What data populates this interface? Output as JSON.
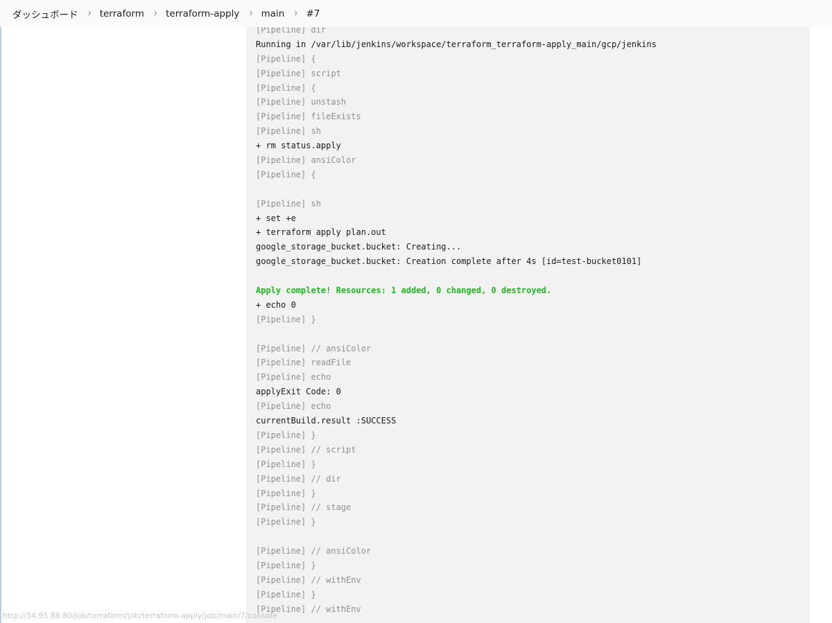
{
  "breadcrumb": {
    "items": [
      "ダッシュボード",
      "terraform",
      "terraform-apply",
      "main",
      "#7"
    ],
    "separator": "›"
  },
  "console": {
    "lines": [
      {
        "text": "[Pipeline] dir",
        "kind": "pipeline"
      },
      {
        "text": "Running in /var/lib/jenkins/workspace/terraform_terraform-apply_main/gcp/jenkins",
        "kind": "output"
      },
      {
        "text": "[Pipeline] {",
        "kind": "pipeline"
      },
      {
        "text": "[Pipeline] script",
        "kind": "pipeline"
      },
      {
        "text": "[Pipeline] {",
        "kind": "pipeline"
      },
      {
        "text": "[Pipeline] unstash",
        "kind": "pipeline"
      },
      {
        "text": "[Pipeline] fileExists",
        "kind": "pipeline"
      },
      {
        "text": "[Pipeline] sh",
        "kind": "pipeline"
      },
      {
        "text": "+ rm status.apply",
        "kind": "output"
      },
      {
        "text": "[Pipeline] ansiColor",
        "kind": "pipeline"
      },
      {
        "text": "[Pipeline] {",
        "kind": "pipeline"
      },
      {
        "text": "",
        "kind": "blank"
      },
      {
        "text": "[Pipeline] sh",
        "kind": "pipeline"
      },
      {
        "text": "+ set +e",
        "kind": "output"
      },
      {
        "text": "+ terraform apply plan.out",
        "kind": "output"
      },
      {
        "text": "google_storage_bucket.bucket: Creating...",
        "kind": "output"
      },
      {
        "text": "google_storage_bucket.bucket: Creation complete after 4s [id=test-bucket0101]",
        "kind": "output"
      },
      {
        "text": "",
        "kind": "blank"
      },
      {
        "text": "Apply complete! Resources: 1 added, 0 changed, 0 destroyed.",
        "kind": "success"
      },
      {
        "text": "+ echo 0",
        "kind": "output"
      },
      {
        "text": "[Pipeline] }",
        "kind": "pipeline"
      },
      {
        "text": "",
        "kind": "blank"
      },
      {
        "text": "[Pipeline] // ansiColor",
        "kind": "pipeline"
      },
      {
        "text": "[Pipeline] readFile",
        "kind": "pipeline"
      },
      {
        "text": "[Pipeline] echo",
        "kind": "pipeline"
      },
      {
        "text": "applyExit Code: 0",
        "kind": "output"
      },
      {
        "text": "[Pipeline] echo",
        "kind": "pipeline"
      },
      {
        "text": "currentBuild.result :SUCCESS",
        "kind": "output"
      },
      {
        "text": "[Pipeline] }",
        "kind": "pipeline"
      },
      {
        "text": "[Pipeline] // script",
        "kind": "pipeline"
      },
      {
        "text": "[Pipeline] }",
        "kind": "pipeline"
      },
      {
        "text": "[Pipeline] // dir",
        "kind": "pipeline"
      },
      {
        "text": "[Pipeline] }",
        "kind": "pipeline"
      },
      {
        "text": "[Pipeline] // stage",
        "kind": "pipeline"
      },
      {
        "text": "[Pipeline] }",
        "kind": "pipeline"
      },
      {
        "text": "",
        "kind": "blank"
      },
      {
        "text": "[Pipeline] // ansiColor",
        "kind": "pipeline"
      },
      {
        "text": "[Pipeline] }",
        "kind": "pipeline"
      },
      {
        "text": "[Pipeline] // withEnv",
        "kind": "pipeline"
      },
      {
        "text": "[Pipeline] }",
        "kind": "pipeline"
      },
      {
        "text": "[Pipeline] // withEnv",
        "kind": "pipeline"
      }
    ]
  },
  "status_bar": {
    "url": "http://34.95.88.80/job/terraform/job/terraform-apply/job/main/7/console"
  },
  "colors": {
    "console_bg": "#f2f2f2",
    "pipeline_text": "#8f8f8f",
    "output_text": "#1a1a1a",
    "success_text": "#1fb81f"
  }
}
